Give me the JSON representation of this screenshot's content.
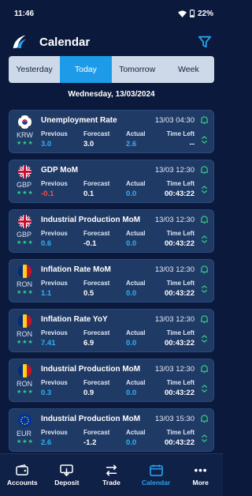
{
  "status": {
    "time": "11:46",
    "battery": "22%"
  },
  "header": {
    "title": "Calendar"
  },
  "tabs": [
    {
      "label": "Yesterday",
      "active": false
    },
    {
      "label": "Today",
      "active": true
    },
    {
      "label": "Tomorrow",
      "active": false
    },
    {
      "label": "Week",
      "active": false
    }
  ],
  "date": "Wednesday, 13/03/2024",
  "labels": {
    "previous": "Previous",
    "forecast": "Forecast",
    "actual": "Actual",
    "time_left": "Time Left"
  },
  "colors": {
    "accent": "#1e9be8",
    "negative": "#ff4b4b",
    "positive": "#2bb3f5",
    "stars": "#2fcf83"
  },
  "events": [
    {
      "currency": "KRW",
      "flag": "kr",
      "stars": "★★★",
      "name": "Unemployment Rate",
      "time": "13/03 04:30",
      "previous": "3.0",
      "previous_tone": "positive",
      "forecast": "3.0",
      "actual": "2.6",
      "time_left": "--"
    },
    {
      "currency": "GBP",
      "flag": "gb",
      "stars": "★★★",
      "name": "GDP MoM",
      "time": "13/03 12:30",
      "previous": "-0.1",
      "previous_tone": "negative",
      "forecast": "0.1",
      "actual": "0.0",
      "time_left": "00:43:22"
    },
    {
      "currency": "GBP",
      "flag": "gb",
      "stars": "★★★",
      "name": "Industrial Production MoM",
      "time": "13/03 12:30",
      "previous": "0.6",
      "previous_tone": "positive",
      "forecast": "-0.1",
      "actual": "0.0",
      "time_left": "00:43:22"
    },
    {
      "currency": "RON",
      "flag": "ro",
      "stars": "★★★",
      "name": "Inflation Rate MoM",
      "time": "13/03 12:30",
      "previous": "1.1",
      "previous_tone": "positive",
      "forecast": "0.5",
      "actual": "0.0",
      "time_left": "00:43:22"
    },
    {
      "currency": "RON",
      "flag": "ro",
      "stars": "★★★",
      "name": "Inflation Rate YoY",
      "time": "13/03 12:30",
      "previous": "7.41",
      "previous_tone": "positive",
      "forecast": "6.9",
      "actual": "0.0",
      "time_left": "00:43:22"
    },
    {
      "currency": "RON",
      "flag": "ro",
      "stars": "★★★",
      "name": "Industrial Production MoM",
      "time": "13/03 12:30",
      "previous": "0.3",
      "previous_tone": "positive",
      "forecast": "0.9",
      "actual": "0.0",
      "time_left": "00:43:22"
    },
    {
      "currency": "EUR",
      "flag": "eu",
      "stars": "★★★",
      "name": "Industrial Production MoM",
      "time": "13/03 15:30",
      "previous": "2.6",
      "previous_tone": "positive",
      "forecast": "-1.2",
      "actual": "0.0",
      "time_left": "00:43:22"
    }
  ],
  "nav": [
    {
      "label": "Accounts",
      "icon": "wallet-icon",
      "active": false
    },
    {
      "label": "Deposit",
      "icon": "deposit-icon",
      "active": false
    },
    {
      "label": "Trade",
      "icon": "trade-arrows-icon",
      "active": false
    },
    {
      "label": "Calendar",
      "icon": "calendar-icon",
      "active": true
    },
    {
      "label": "More",
      "icon": "more-dots-icon",
      "active": false
    }
  ]
}
